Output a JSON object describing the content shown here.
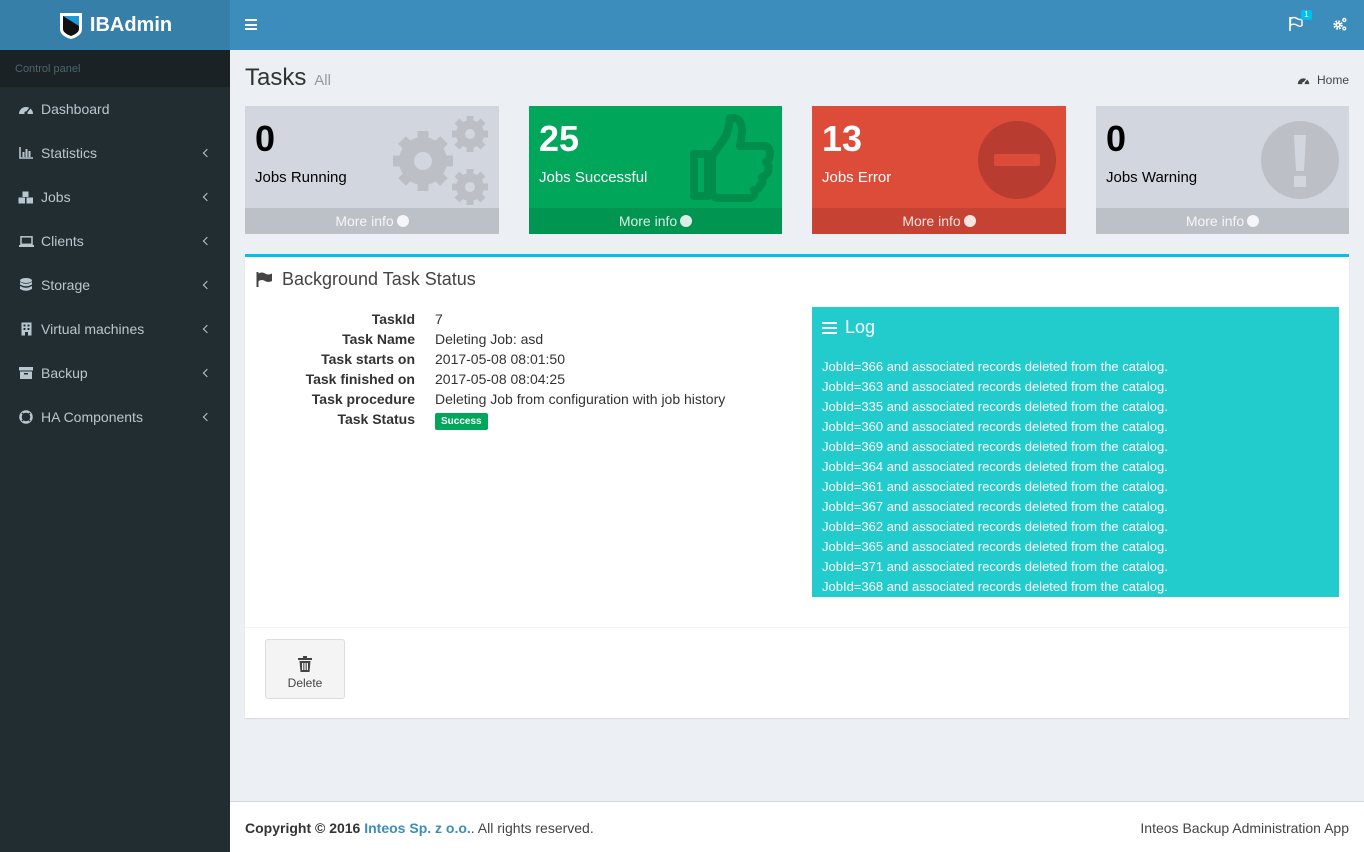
{
  "app": {
    "brand": "IBAdmin",
    "brand_color": "#367fa9",
    "accent": "#3c8dbc"
  },
  "sidebar": {
    "section_label": "Control panel",
    "items": [
      {
        "label": "Dashboard",
        "icon": "dashboard-icon",
        "has_submenu": false
      },
      {
        "label": "Statistics",
        "icon": "bar-chart-icon",
        "has_submenu": true
      },
      {
        "label": "Jobs",
        "icon": "cubes-icon",
        "has_submenu": true
      },
      {
        "label": "Clients",
        "icon": "laptop-icon",
        "has_submenu": true
      },
      {
        "label": "Storage",
        "icon": "database-icon",
        "has_submenu": true
      },
      {
        "label": "Virtual machines",
        "icon": "building-icon",
        "has_submenu": true
      },
      {
        "label": "Backup",
        "icon": "archive-icon",
        "has_submenu": true
      },
      {
        "label": "HA Components",
        "icon": "life-ring-icon",
        "has_submenu": true
      }
    ]
  },
  "topbar": {
    "notifications_count": "1"
  },
  "header": {
    "title": "Tasks",
    "subtitle": "All",
    "breadcrumb": "Home"
  },
  "stat_boxes": [
    {
      "value": "0",
      "label": "Jobs Running",
      "more": "More info",
      "color": "#d2d6de",
      "icon": "cogs-icon"
    },
    {
      "value": "25",
      "label": "Jobs Successful",
      "more": "More info",
      "color": "#00a65a",
      "icon": "thumbs-up-icon"
    },
    {
      "value": "13",
      "label": "Jobs Error",
      "more": "More info",
      "color": "#dd4b39",
      "icon": "minus-circle-icon"
    },
    {
      "value": "0",
      "label": "Jobs Warning",
      "more": "More info",
      "color": "#d2d6de",
      "icon": "exclamation-circle-icon"
    }
  ],
  "task": {
    "box_title": "Background Task Status",
    "fields": [
      {
        "label": "TaskId",
        "value": "7"
      },
      {
        "label": "Task Name",
        "value": "Deleting Job: asd"
      },
      {
        "label": "Task starts on",
        "value": "2017-05-08 08:01:50"
      },
      {
        "label": "Task finished on",
        "value": "2017-05-08 08:04:25"
      },
      {
        "label": "Task procedure",
        "value": "Deleting Job from configuration with job history"
      }
    ],
    "status_label": "Task Status",
    "status_value": "Success",
    "status_color": "#00a65a"
  },
  "log": {
    "title": "Log",
    "color": "#22cccc",
    "lines": [
      "JobId=366 and associated records deleted from the catalog.",
      "JobId=363 and associated records deleted from the catalog.",
      "JobId=335 and associated records deleted from the catalog.",
      "JobId=360 and associated records deleted from the catalog.",
      "JobId=369 and associated records deleted from the catalog.",
      "JobId=364 and associated records deleted from the catalog.",
      "JobId=361 and associated records deleted from the catalog.",
      "JobId=367 and associated records deleted from the catalog.",
      "JobId=362 and associated records deleted from the catalog.",
      "JobId=365 and associated records deleted from the catalog.",
      "JobId=371 and associated records deleted from the catalog.",
      "JobId=368 and associated records deleted from the catalog."
    ]
  },
  "actions": {
    "delete_label": "Delete"
  },
  "footer": {
    "copyright_prefix": "Copyright © 2016",
    "company": "Inteos Sp. z o.o.",
    "rights": ". All rights reserved.",
    "app_name": "Inteos Backup Administration App"
  }
}
